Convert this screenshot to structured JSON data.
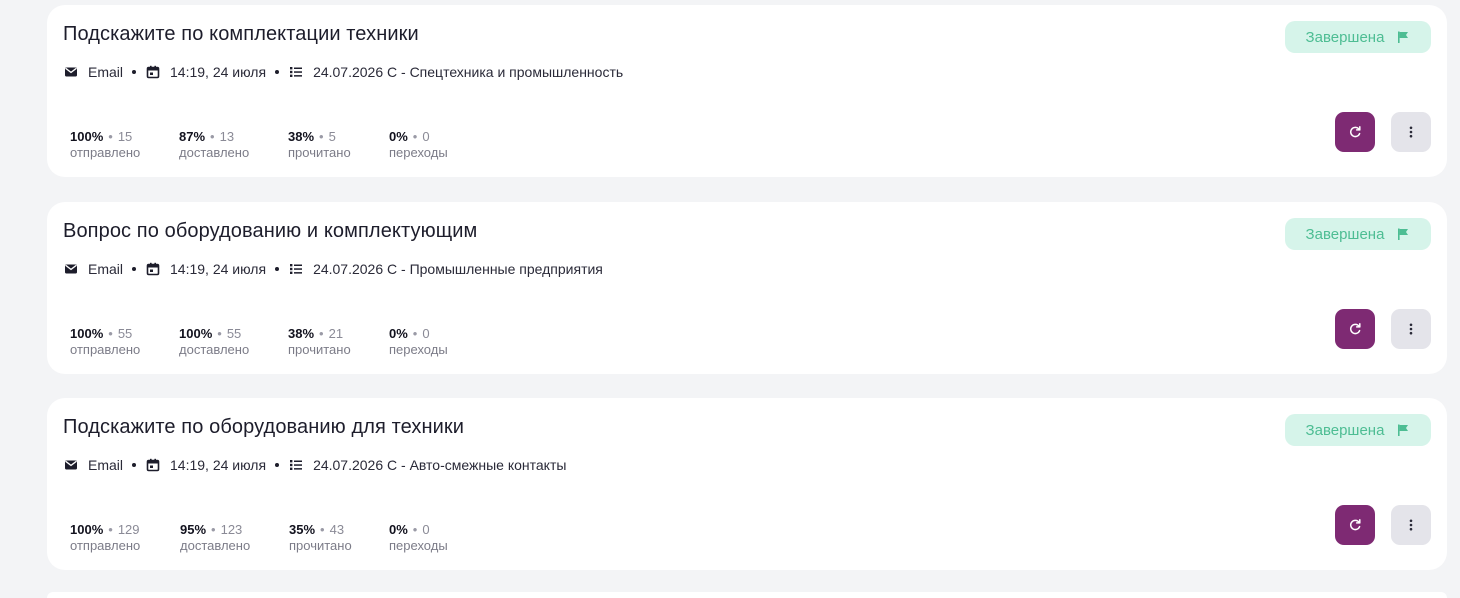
{
  "colors": {
    "background": "#f3f4f6",
    "card": "#ffffff",
    "accent": "#7e2a73",
    "status_bg": "#d6f4ea",
    "status_text": "#4dbd93",
    "more_bg": "#e4e4ea"
  },
  "icons": {
    "channel": "envelope-icon",
    "date": "calendar-icon",
    "list": "list-icon",
    "status": "flag-icon",
    "refresh": "refresh-icon",
    "more": "more-vertical-icon"
  },
  "campaigns": [
    {
      "title": "Подскажите по комплектации техники",
      "channel": "Email",
      "datetime": "14:19, 24 июля",
      "list": "24.07.2026 С - Спецтехника и промышленность",
      "status": "Завершена",
      "stats": [
        {
          "pct": "100%",
          "count": "15",
          "label": "отправлено"
        },
        {
          "pct": "87%",
          "count": "13",
          "label": "доставлено"
        },
        {
          "pct": "38%",
          "count": "5",
          "label": "прочитано"
        },
        {
          "pct": "0%",
          "count": "0",
          "label": "переходы"
        }
      ]
    },
    {
      "title": "Вопрос по оборудованию и комплектующим",
      "channel": "Email",
      "datetime": "14:19, 24 июля",
      "list": "24.07.2026 С - Промышленные предприятия",
      "status": "Завершена",
      "stats": [
        {
          "pct": "100%",
          "count": "55",
          "label": "отправлено"
        },
        {
          "pct": "100%",
          "count": "55",
          "label": "доставлено"
        },
        {
          "pct": "38%",
          "count": "21",
          "label": "прочитано"
        },
        {
          "pct": "0%",
          "count": "0",
          "label": "переходы"
        }
      ]
    },
    {
      "title": "Подскажите по оборудованию для техники",
      "channel": "Email",
      "datetime": "14:19, 24 июля",
      "list": "24.07.2026 С - Авто-смежные контакты",
      "status": "Завершена",
      "stats": [
        {
          "pct": "100%",
          "count": "129",
          "label": "отправлено"
        },
        {
          "pct": "95%",
          "count": "123",
          "label": "доставлено"
        },
        {
          "pct": "35%",
          "count": "43",
          "label": "прочитано"
        },
        {
          "pct": "0%",
          "count": "0",
          "label": "переходы"
        }
      ]
    }
  ]
}
